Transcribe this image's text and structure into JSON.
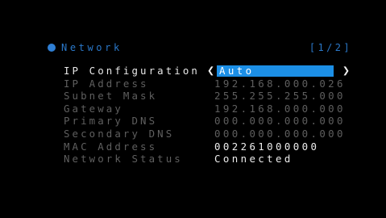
{
  "header": {
    "title": "Network",
    "page_indicator": "[1/2]"
  },
  "rows": [
    {
      "label": "IP Configuration",
      "value": "Auto"
    },
    {
      "label": "IP Address",
      "value": "192.168.000.026"
    },
    {
      "label": "Subnet Mask",
      "value": "255.255.255.000"
    },
    {
      "label": "Gateway",
      "value": "192.168.000.000"
    },
    {
      "label": "Primary DNS",
      "value": "000.000.000.000"
    },
    {
      "label": "Secondary DNS",
      "value": "000.000.000.000"
    },
    {
      "label": "MAC Address",
      "value": "002261000000"
    },
    {
      "label": "Network Status",
      "value": "Connected"
    }
  ],
  "icons": {
    "network": "network-dot-icon",
    "left": "chevron-left-icon",
    "right": "chevron-right-icon"
  },
  "colors": {
    "background": "#000000",
    "accent": "#1c8fe6",
    "header": "#2a78c9",
    "dim_text": "#5f5f5f",
    "bright_text": "#ececec"
  }
}
